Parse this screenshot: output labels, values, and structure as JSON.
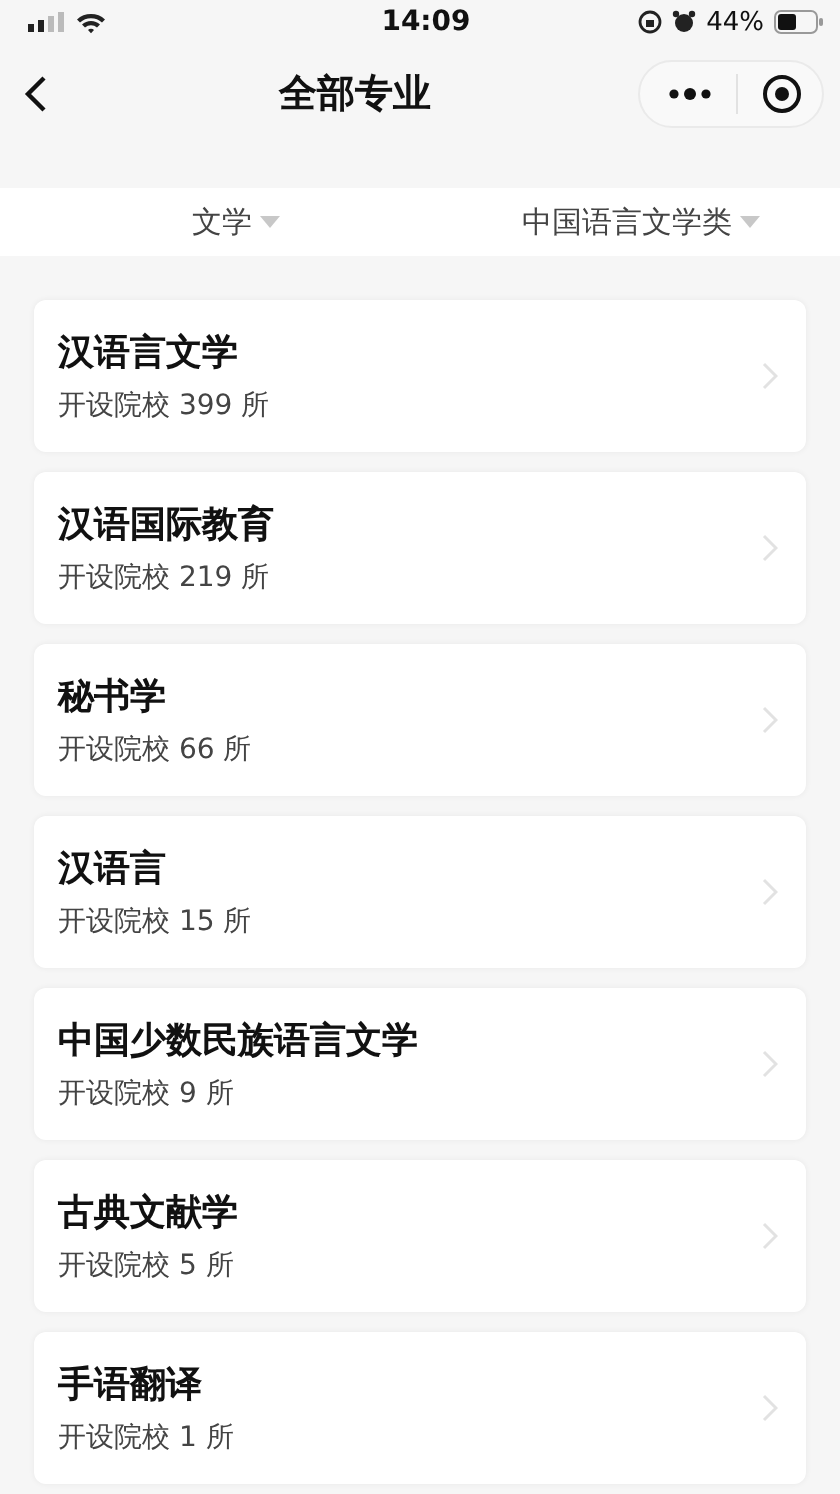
{
  "status_bar": {
    "time": "14:09",
    "battery": "44%"
  },
  "nav_bar": {
    "title": "全部专业"
  },
  "filters": [
    {
      "label": "文学"
    },
    {
      "label": "中国语言文学类"
    }
  ],
  "majors": [
    {
      "name": "汉语言文学",
      "schools": "开设院校 399 所"
    },
    {
      "name": "汉语国际教育",
      "schools": "开设院校 219 所"
    },
    {
      "name": "秘书学",
      "schools": "开设院校 66 所"
    },
    {
      "name": "汉语言",
      "schools": "开设院校 15 所"
    },
    {
      "name": "中国少数民族语言文学",
      "schools": "开设院校 9 所"
    },
    {
      "name": "古典文献学",
      "schools": "开设院校 5 所"
    },
    {
      "name": "手语翻译",
      "schools": "开设院校 1 所"
    }
  ]
}
